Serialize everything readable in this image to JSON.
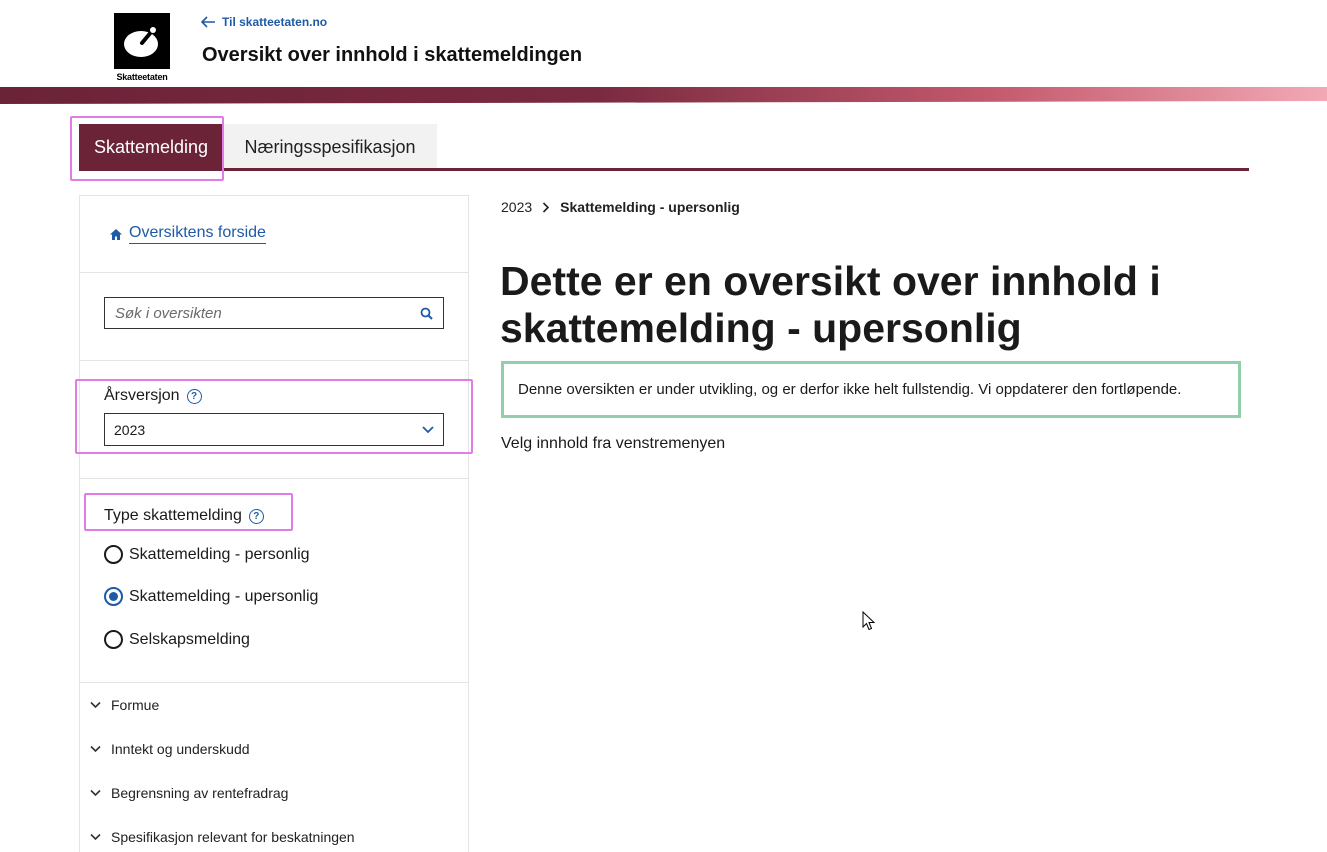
{
  "header": {
    "logo_text": "Skatteetaten",
    "back_link": "Til skatteetaten.no",
    "title": "Oversikt over innhold i skattemeldingen"
  },
  "tabs": [
    {
      "label": "Skattemelding",
      "active": true
    },
    {
      "label": "Næringsspesifikasjon",
      "active": false
    }
  ],
  "sidebar": {
    "home_link": "Oversiktens forside",
    "search_placeholder": "Søk i oversikten",
    "year_label": "Årsversjon",
    "year_value": "2023",
    "type_label": "Type skattemelding",
    "type_options": [
      {
        "label": "Skattemelding - personlig",
        "checked": false
      },
      {
        "label": "Skattemelding - upersonlig",
        "checked": true
      },
      {
        "label": "Selskapsmelding",
        "checked": false
      }
    ],
    "nav_items": [
      "Formue",
      "Inntekt og underskudd",
      "Begrensning av rentefradrag",
      "Spesifikasjon relevant for beskatningen"
    ]
  },
  "main": {
    "breadcrumb": [
      "2023",
      "Skattemelding - upersonlig"
    ],
    "title": "Dette er en oversikt over innhold i skattemelding - upersonlig",
    "notice": "Denne oversikten er under utvikling, og er derfor ikke helt fullstendig. Vi oppdaterer den fortløpende.",
    "hint": "Velg innhold fra venstremenyen"
  },
  "colors": {
    "brand": "#6b2338",
    "link": "#1f5aa6",
    "notice_border": "#92ceab",
    "highlight": "#e27be6"
  }
}
